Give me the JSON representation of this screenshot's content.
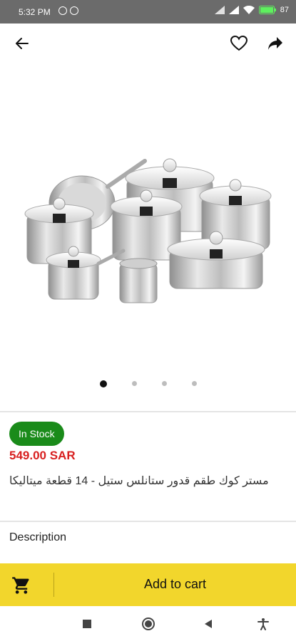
{
  "status_bar": {
    "time": "5:32 PM",
    "battery": "87"
  },
  "app_bar": {
    "back_icon": "arrow-left-icon",
    "favorite_icon": "heart-icon",
    "share_icon": "share-arrow-icon"
  },
  "gallery": {
    "total_images": 4,
    "active_index": 0,
    "image_subject": "cookware set"
  },
  "product": {
    "stock_status": "In Stock",
    "price": "549.00 SAR",
    "title": "مستر كوك طقم قدور ستانلس ستيل - 14 قطعة ميتاليكا",
    "description_label": "Description"
  },
  "cart": {
    "add_to_cart_label": "Add to cart",
    "icon": "cart-icon"
  },
  "colors": {
    "accent_yellow": "#f2d62c",
    "in_stock_green": "#1a8b1a",
    "price_red": "#d81f1f"
  }
}
